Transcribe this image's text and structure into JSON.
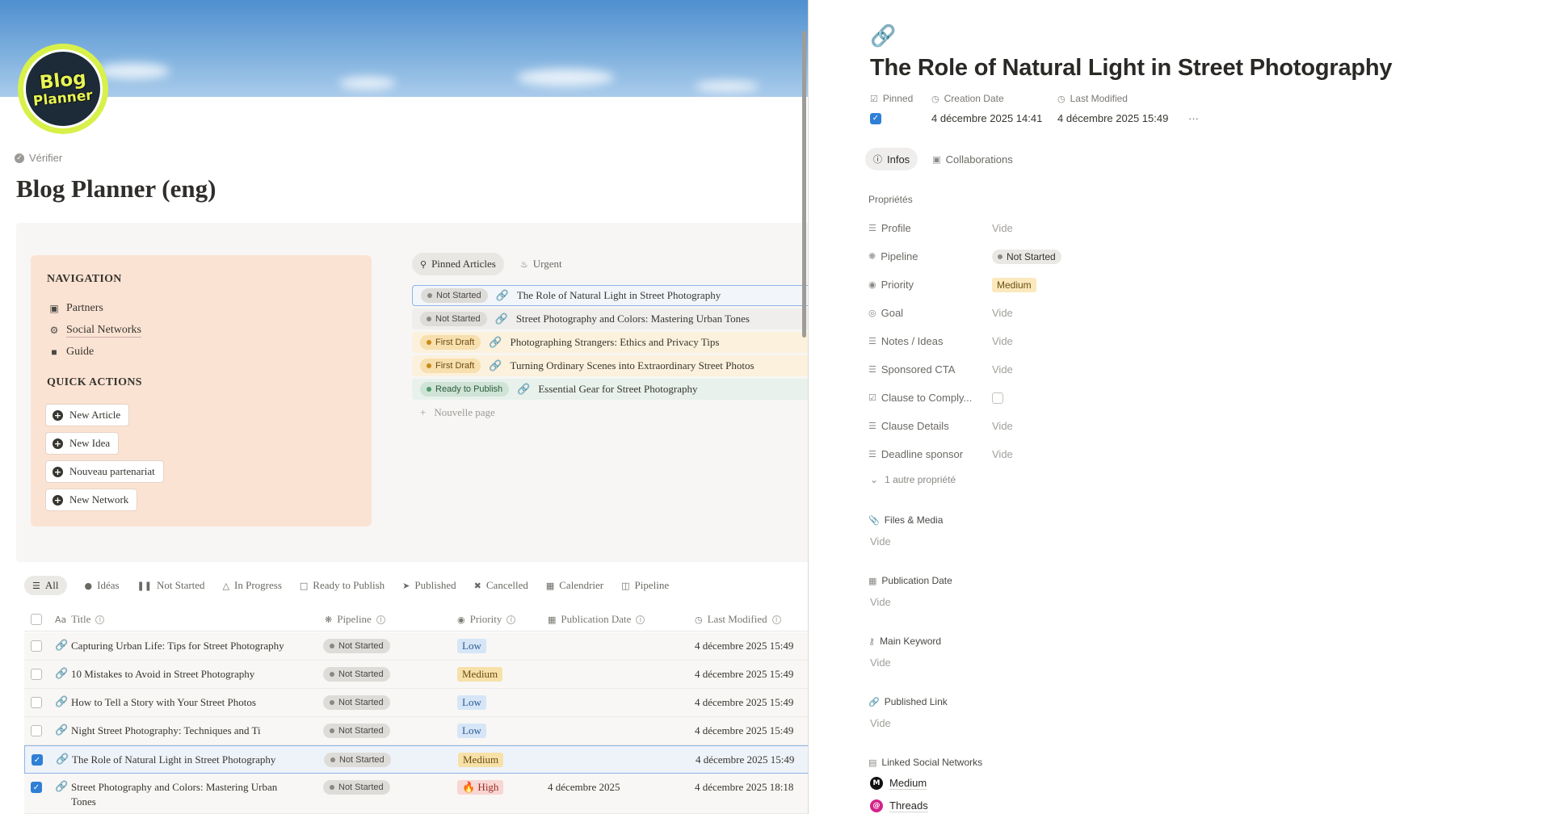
{
  "page": {
    "verify_label": "Vérifier",
    "title": "Blog Planner (eng)",
    "logo_line1": "Blog",
    "logo_line2": "Planner"
  },
  "navigation": {
    "heading": "NAVIGATION",
    "items": [
      {
        "label": "Partners",
        "icon": "briefcase-icon"
      },
      {
        "label": "Social Networks",
        "icon": "network-icon"
      },
      {
        "label": "Guide",
        "icon": "book-icon"
      }
    ]
  },
  "quick_actions": {
    "heading": "QUICK ACTIONS",
    "buttons": [
      "New Article",
      "New Idea",
      "Nouveau partenariat",
      "New Network"
    ]
  },
  "pinned": {
    "tabs": [
      "Pinned Articles",
      "Urgent"
    ],
    "rows": [
      {
        "status": "Not Started",
        "title": "The Role of Natural Light in Street Photography"
      },
      {
        "status": "Not Started",
        "title": "Street Photography and Colors: Mastering Urban Tones"
      },
      {
        "status": "First Draft",
        "title": "Photographing Strangers: Ethics and Privacy Tips"
      },
      {
        "status": "First Draft",
        "title": "Turning Ordinary Scenes into Extraordinary Street Photos"
      },
      {
        "status": "Ready to Publish",
        "title": "Essential Gear for Street Photography"
      }
    ],
    "new_page": "Nouvelle page"
  },
  "views": [
    "All",
    "Idéas",
    "Not Started",
    "In Progress",
    "Ready to Publish",
    "Published",
    "Cancelled",
    "Calendrier",
    "Pipeline"
  ],
  "table": {
    "columns": {
      "title": "Title",
      "pipeline": "Pipeline",
      "priority": "Priority",
      "publication_date": "Publication Date",
      "last_modified": "Last Modified"
    },
    "rows": [
      {
        "title": "Capturing Urban Life: Tips for Street Photography",
        "pipeline": "Not Started",
        "priority": "Low",
        "pub": "",
        "modified": "4 décembre 2025 15:49",
        "checked": false
      },
      {
        "title": "10 Mistakes to Avoid in Street Photography",
        "pipeline": "Not Started",
        "priority": "Medium",
        "pub": "",
        "modified": "4 décembre 2025 15:49",
        "checked": false
      },
      {
        "title": "How to Tell a Story with Your Street Photos",
        "pipeline": "Not Started",
        "priority": "Low",
        "pub": "",
        "modified": "4 décembre 2025 15:49",
        "checked": false
      },
      {
        "title": "Night Street Photography: Techniques and Ti",
        "pipeline": "Not Started",
        "priority": "Low",
        "pub": "",
        "modified": "4 décembre 2025 15:49",
        "checked": false
      },
      {
        "title": "The Role of Natural Light in Street Photography",
        "pipeline": "Not Started",
        "priority": "Medium",
        "pub": "",
        "modified": "4 décembre 2025 15:49",
        "checked": true
      },
      {
        "title": "Street Photography and Colors: Mastering Urban",
        "title2": "Tones",
        "pipeline": "Not Started",
        "priority": "🔥 High",
        "pub": "4 décembre 2025",
        "modified": "4 décembre 2025 18:18",
        "checked": true
      }
    ]
  },
  "detail": {
    "title": "The Role of Natural Light in Street Photography",
    "meta": {
      "pinned_label": "Pinned",
      "created_label": "Creation Date",
      "created_value": "4 décembre 2025 14:41",
      "modified_label": "Last Modified",
      "modified_value": "4 décembre 2025 15:49",
      "more": "···"
    },
    "tabs": [
      "Infos",
      "Collaborations"
    ],
    "props_heading": "Propriétés",
    "properties": [
      {
        "key": "Profile",
        "value": "Vide"
      },
      {
        "key": "Pipeline",
        "value": "Not Started"
      },
      {
        "key": "Priority",
        "value": "Medium"
      },
      {
        "key": "Goal",
        "value": "Vide"
      },
      {
        "key": "Notes / Ideas",
        "value": "Vide"
      },
      {
        "key": "Sponsored CTA",
        "value": "Vide"
      },
      {
        "key": "Clause to Comply...",
        "value": ""
      },
      {
        "key": "Clause Details",
        "value": "Vide"
      },
      {
        "key": "Deadline sponsor",
        "value": "Vide"
      }
    ],
    "more_props": "1 autre propriété",
    "blocks": [
      {
        "heading": "Files & Media",
        "value": "Vide"
      },
      {
        "heading": "Publication Date",
        "value": "Vide"
      },
      {
        "heading": "Main Keyword",
        "value": "Vide"
      },
      {
        "heading": "Published Link",
        "value": "Vide"
      }
    ],
    "social_heading": "Linked Social Networks",
    "socials": [
      {
        "name": "Medium",
        "color": "#111111"
      },
      {
        "name": "Threads",
        "color": "#d4228a"
      }
    ]
  },
  "colors": {
    "accent_blue": "#2f7fd6",
    "nav_card": "#fbe3d4",
    "logo_green": "#d8f04a"
  }
}
